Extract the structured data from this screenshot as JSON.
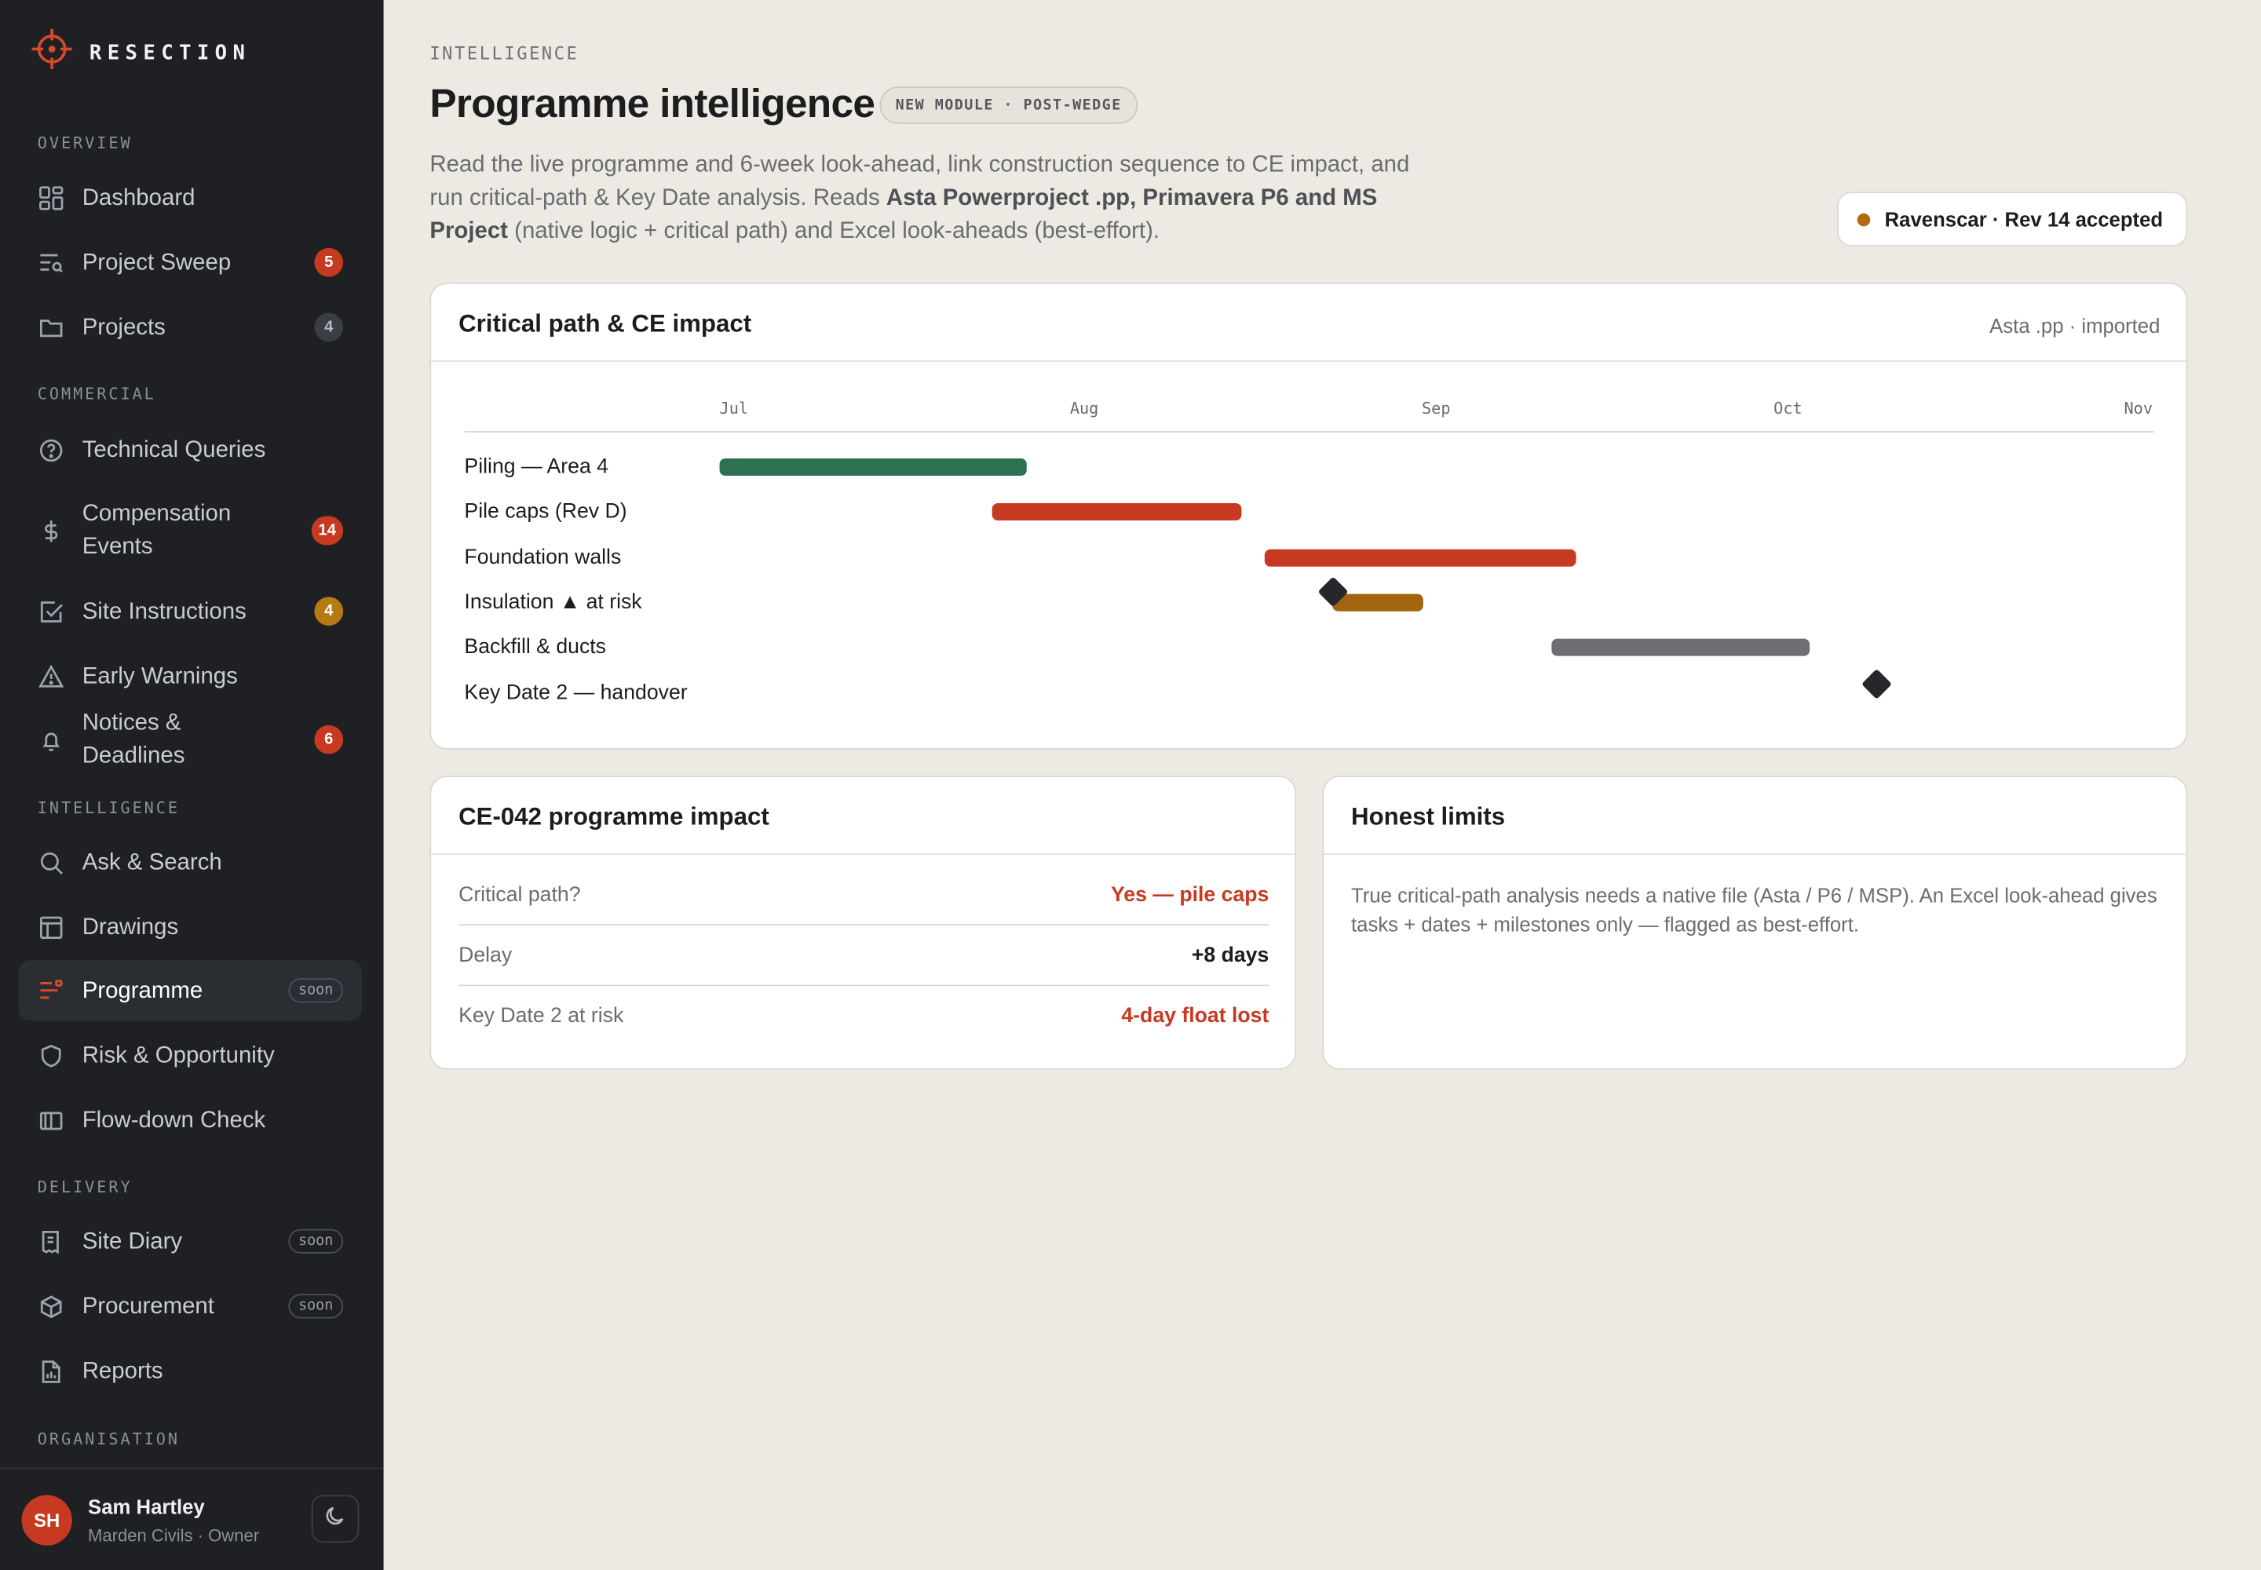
{
  "brand": {
    "name": "RESECTION"
  },
  "sidebar": {
    "sections": {
      "overview": "OVERVIEW",
      "commercial": "COMMERCIAL",
      "intelligence": "INTELLIGENCE",
      "delivery": "DELIVERY",
      "organisation": "ORGANISATION"
    },
    "items": [
      {
        "label": "Dashboard",
        "icon": "dashboard-icon"
      },
      {
        "label": "Project Sweep",
        "icon": "sweep-icon",
        "badge": "5",
        "badge_color": "#c73a22"
      },
      {
        "label": "Projects",
        "icon": "folder-icon",
        "badge": "4",
        "badge_color": "#3a3d43"
      },
      {
        "label": "Technical Queries",
        "icon": "question-icon"
      },
      {
        "label": "Compensation Events",
        "icon": "dollar-icon",
        "badge": "14",
        "badge_color": "#c73a22"
      },
      {
        "label": "Site Instructions",
        "icon": "check-square-icon",
        "badge": "4",
        "badge_color": "#b67a14"
      },
      {
        "label": "Early Warnings",
        "icon": "warning-icon"
      },
      {
        "label": "Notices & Deadlines",
        "icon": "bell-icon",
        "badge": "6",
        "badge_color": "#c73a22"
      },
      {
        "label": "Ask & Search",
        "icon": "search-icon"
      },
      {
        "label": "Drawings",
        "icon": "layout-icon"
      },
      {
        "label": "Programme",
        "icon": "programme-icon",
        "tag": "soon",
        "active": true
      },
      {
        "label": "Risk & Opportunity",
        "icon": "shield-icon"
      },
      {
        "label": "Flow-down Check",
        "icon": "columns-icon"
      },
      {
        "label": "Site Diary",
        "icon": "diary-icon",
        "tag": "soon"
      },
      {
        "label": "Procurement",
        "icon": "box-icon",
        "tag": "soon"
      },
      {
        "label": "Reports",
        "icon": "report-icon"
      }
    ]
  },
  "profile": {
    "initials": "SH",
    "name": "Sam Hartley",
    "subtitle": "Marden Civils · Owner"
  },
  "header": {
    "eyebrow": "INTELLIGENCE",
    "title": "Programme intelligence",
    "chip": "NEW MODULE · POST-WEDGE",
    "desc_1": "Read the live programme and 6-week look-ahead, link construction sequence to CE impact, and run critical-path & Key Date analysis. Reads ",
    "desc_bold": "Asta Powerproject .pp, Primavera P6 and MS Project",
    "desc_2": " (native logic + critical path) and Excel look-aheads (best-effort).",
    "project_status": "Ravenscar · Rev 14 accepted"
  },
  "gantt": {
    "title": "Critical path & CE impact",
    "source": "Asta .pp · imported",
    "months": [
      "Jul",
      "Aug",
      "Sep",
      "Oct",
      "Nov"
    ],
    "tasks": [
      {
        "label": "Piling — Area 4",
        "start": "Jul 1",
        "end": "Jul 28",
        "color": "#2e7052"
      },
      {
        "label": "Pile caps (Rev D)",
        "start": "Jul 25",
        "end": "Aug 16",
        "color": "#c73a22"
      },
      {
        "label": "Foundation walls",
        "start": "Aug 18",
        "end": "Sep 14",
        "color": "#c73a22"
      },
      {
        "label": "Insulation ▲ at risk",
        "start": "Aug 24",
        "end": "Sep 1",
        "color": "#a0650e",
        "milestone": "Aug 24"
      },
      {
        "label": "Backfill & ducts",
        "start": "Sep 12",
        "end": "Oct 4",
        "color": "#6d6f74"
      },
      {
        "label": "Key Date 2 — handover",
        "milestone": "Oct 10"
      }
    ]
  },
  "impact": {
    "title": "CE-042 programme impact",
    "rows": [
      {
        "key": "Critical path?",
        "value": "Yes — pile caps",
        "highlight": true
      },
      {
        "key": "Delay",
        "value": "+8 days",
        "highlight": false
      },
      {
        "key": "Key Date 2 at risk",
        "value": "4-day float lost",
        "highlight": true
      }
    ]
  },
  "limits": {
    "title": "Honest limits",
    "text": "True critical-path analysis needs a native file (Asta / P6 / MSP). An Excel look-ahead gives tasks + dates + milestones only — flagged as best-effort."
  }
}
